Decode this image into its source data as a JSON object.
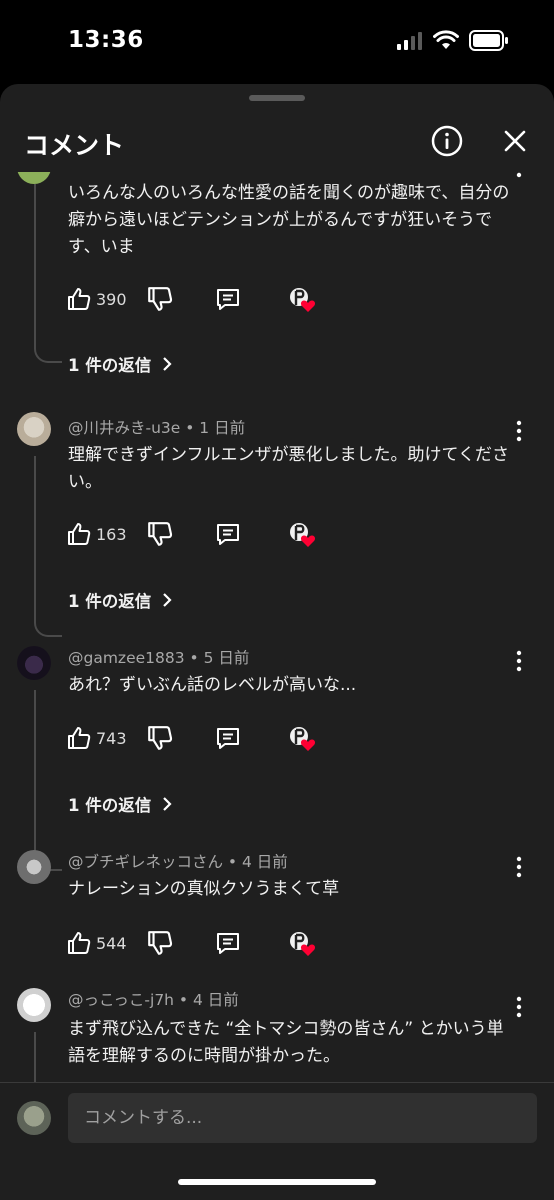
{
  "status_bar": {
    "time": "13:36"
  },
  "sheet": {
    "title": "コメント"
  },
  "comments": [
    {
      "meta": "",
      "text": "いろんな人のいろんな性愛の話を聞くのが趣味で、自分の癖から遠いほどテンションが上がるんですが狂いそうです、いま",
      "likes": "390",
      "replies": "1 件の返信"
    },
    {
      "meta": "@川井みき-u3e • 1 日前",
      "text": "理解できずインフルエンザが悪化しました。助けてください。",
      "likes": "163",
      "replies": "1 件の返信"
    },
    {
      "meta": "@gamzee1883 • 5 日前",
      "text": "あれ？ずいぶん話のレベルが高いな...",
      "likes": "743",
      "replies": "1 件の返信"
    },
    {
      "meta": "@ブチギレネッコさん • 4 日前",
      "text": "ナレーションの真似クソうまくて草",
      "likes": "544",
      "replies": ""
    },
    {
      "meta": "@っこっこ-j7h • 4 日前",
      "text": "まず飛び込んできた “全トマシコ勢の皆さん” とかいう単語を理解するのに時間が掛かった。",
      "likes": "",
      "replies": ""
    }
  ],
  "compose": {
    "placeholder": "コメントする..."
  },
  "colors": {
    "background": "#1f1f1f",
    "heart": "#ff0033",
    "text": "#f1f1f1",
    "meta": "#a8a8a8"
  }
}
